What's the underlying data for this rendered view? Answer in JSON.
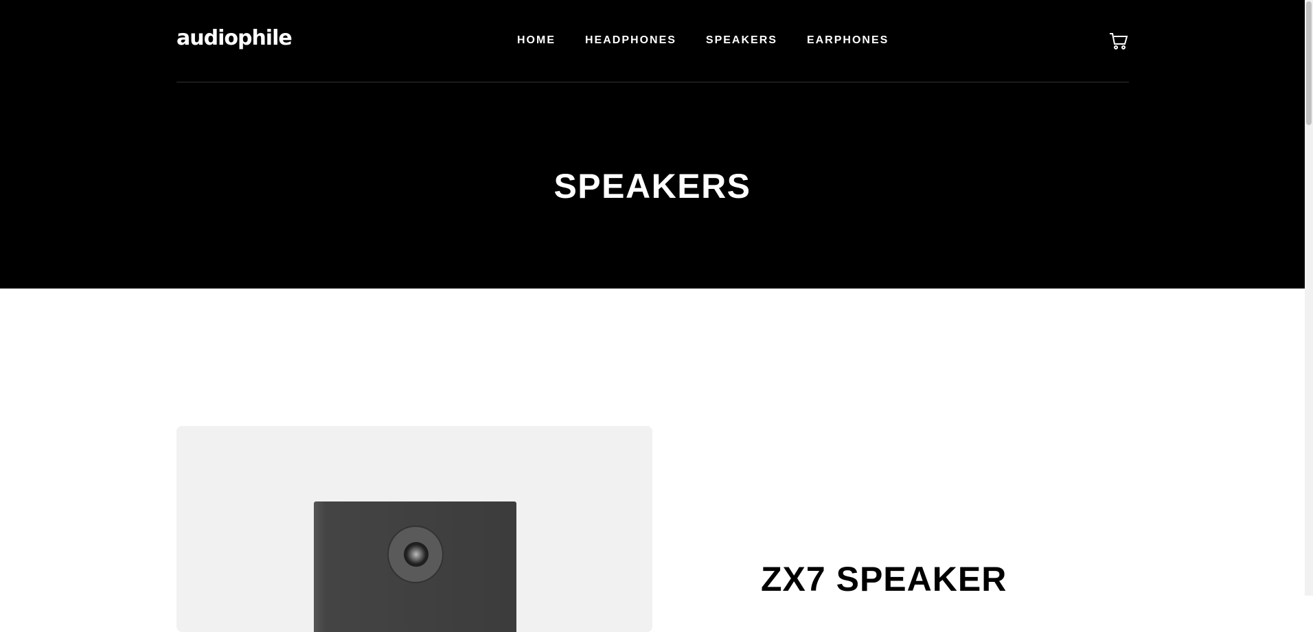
{
  "header": {
    "logo": "audiophile",
    "nav": [
      "HOME",
      "HEADPHONES",
      "SPEAKERS",
      "EARPHONES"
    ],
    "cart_icon": "cart-icon"
  },
  "hero": {
    "title": "SPEAKERS"
  },
  "product": {
    "name": "ZX7 SPEAKER",
    "card_bg": "#f1f1f1"
  }
}
